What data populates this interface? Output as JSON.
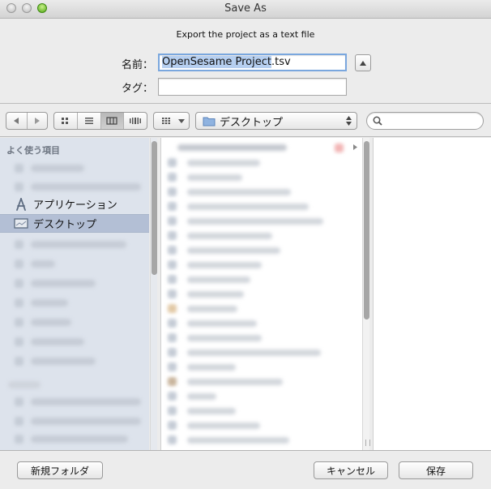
{
  "window": {
    "title": "Save As"
  },
  "dialog": {
    "message": "Export the project as a text file"
  },
  "form": {
    "name_label": "名前：",
    "name_value_selected": "OpenSesame Project",
    "name_value_ext": ".tsv",
    "tags_label": "タグ：",
    "tags_value": ""
  },
  "toolbar": {
    "back_icon": "left-arrow-icon",
    "forward_icon": "right-arrow-icon",
    "views": [
      "icon-view",
      "list-view",
      "column-view",
      "coverflow-view"
    ],
    "active_view": "column-view",
    "arrange_icon": "arrange-grid-icon",
    "location": "デスクトップ",
    "search_placeholder": ""
  },
  "sidebar": {
    "section_header": "よく使う項目",
    "items": [
      {
        "label": "アプリケーション",
        "icon": "applications-icon"
      },
      {
        "label": "デスクトップ",
        "icon": "desktop-folder-icon",
        "selected": true
      }
    ]
  },
  "buttons": {
    "new_folder": "新規フォルダ",
    "cancel": "キャンセル",
    "save": "保存"
  },
  "colors": {
    "selection_text": "#b6cff0",
    "focus_ring": "#7aa7de",
    "sidebar_bg": "#dde3ec",
    "sidebar_selected": "#b3bfd5"
  }
}
